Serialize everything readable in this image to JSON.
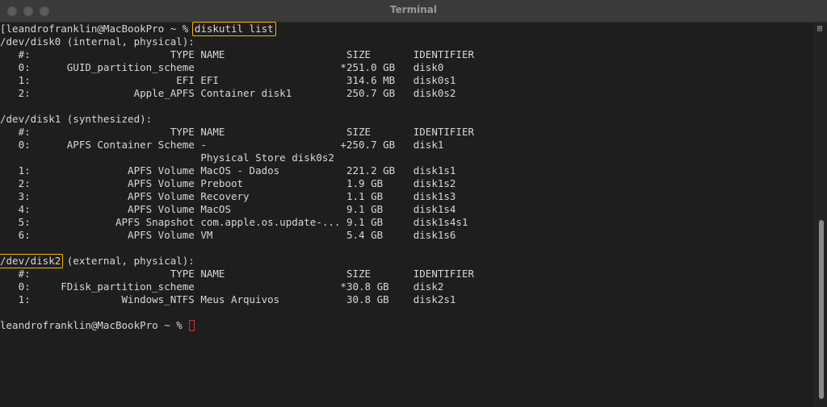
{
  "window": {
    "title": "Terminal"
  },
  "terminal": {
    "lines": [
      "[leandrofranklin@MacBookPro ~ % diskutil list",
      "/dev/disk0 (internal, physical):",
      "   #:                       TYPE NAME                    SIZE       IDENTIFIER",
      "   0:      GUID_partition_scheme                        *251.0 GB   disk0",
      "   1:                        EFI EFI                     314.6 MB   disk0s1",
      "   2:                 Apple_APFS Container disk1         250.7 GB   disk0s2",
      "",
      "/dev/disk1 (synthesized):",
      "   #:                       TYPE NAME                    SIZE       IDENTIFIER",
      "   0:      APFS Container Scheme -                      +250.7 GB   disk1",
      "                                 Physical Store disk0s2",
      "   1:                APFS Volume MacOS - Dados           221.2 GB   disk1s1",
      "   2:                APFS Volume Preboot                 1.9 GB     disk1s2",
      "   3:                APFS Volume Recovery                1.1 GB     disk1s3",
      "   4:                APFS Volume MacOS                   9.1 GB     disk1s4",
      "   5:              APFS Snapshot com.apple.os.update-... 9.1 GB     disk1s4s1",
      "   6:                APFS Volume VM                      5.4 GB     disk1s6",
      "",
      "/dev/disk2 (external, physical):",
      "   #:                       TYPE NAME                    SIZE       IDENTIFIER",
      "   0:     FDisk_partition_scheme                        *30.8 GB    disk2",
      "   1:               Windows_NTFS Meus Arquivos           30.8 GB    disk2s1",
      "",
      "leandrofranklin@MacBookPro ~ % "
    ]
  },
  "highlights": {
    "command": "diskutil list",
    "disk": "/dev/disk2"
  },
  "colors": {
    "highlight": "#f5b700",
    "cursor": "#d0312d",
    "text": "#d7d7d7",
    "background": "#1e1e1e"
  }
}
